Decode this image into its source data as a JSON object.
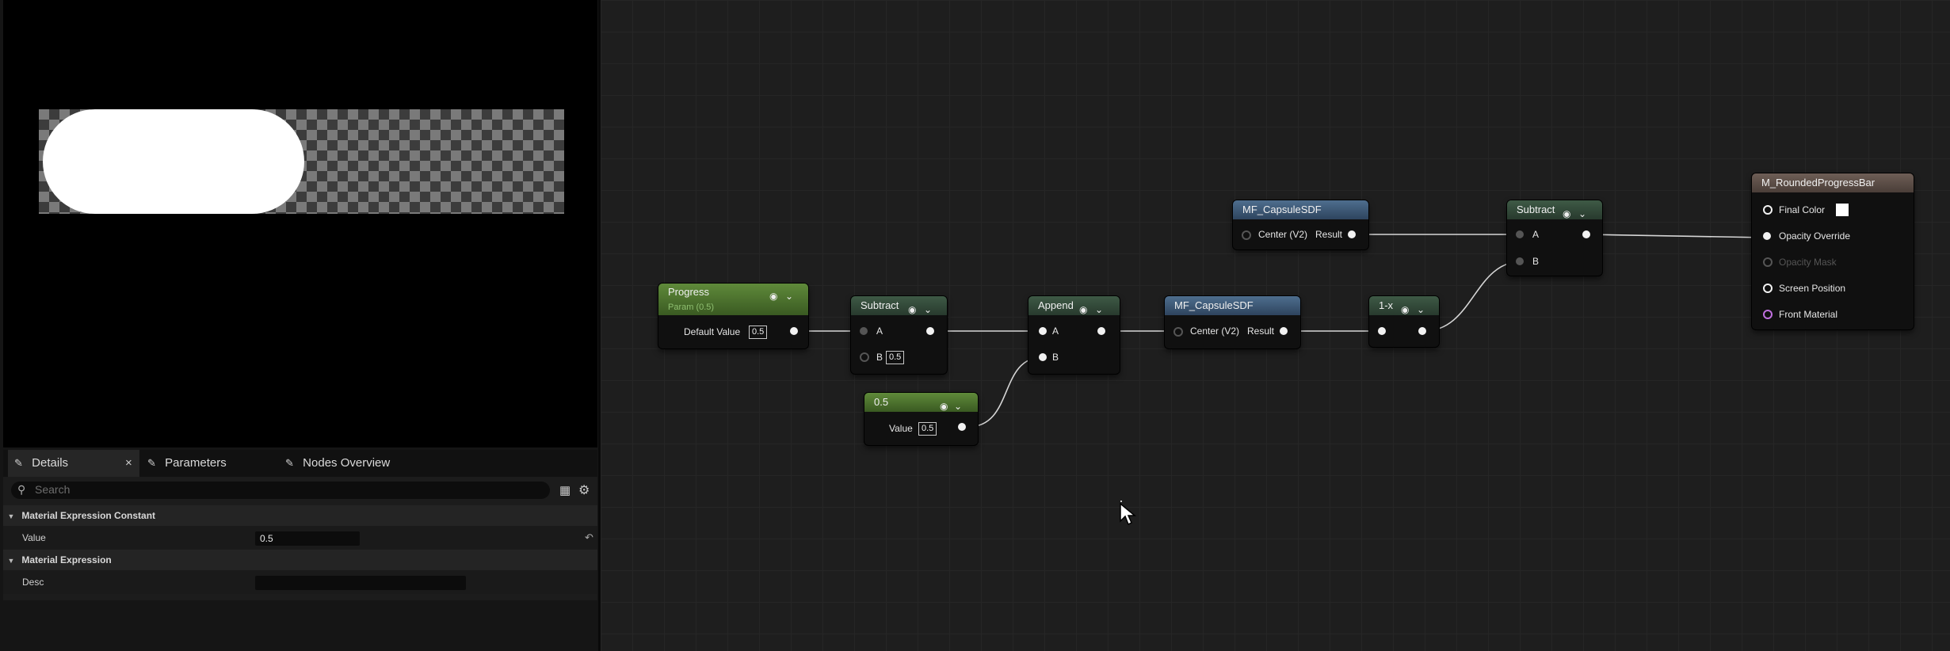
{
  "tabs": {
    "details": "Details",
    "close": "×",
    "parameters": "Parameters",
    "nodes_overview": "Nodes Overview"
  },
  "search": {
    "placeholder": "Search"
  },
  "sections": {
    "constant": {
      "title": "Material Expression Constant",
      "value_label": "Value",
      "value": "0.5"
    },
    "expression": {
      "title": "Material Expression",
      "desc_label": "Desc",
      "desc_value": ""
    }
  },
  "nodes": {
    "progress": {
      "title": "Progress",
      "subtitle": "Param (0.5)",
      "pin_label": "Default Value",
      "value": "0.5"
    },
    "subtract1": {
      "title": "Subtract",
      "pin_a": "A",
      "pin_b": "B",
      "b_value": "0.5"
    },
    "constant": {
      "title": "0.5",
      "pin_label": "Value",
      "value": "0.5"
    },
    "append": {
      "title": "Append",
      "pin_a": "A",
      "pin_b": "B"
    },
    "capsule_bottom": {
      "title": "MF_CapsuleSDF",
      "input": "Center (V2)",
      "output": "Result"
    },
    "capsule_top": {
      "title": "MF_CapsuleSDF",
      "input": "Center (V2)",
      "output": "Result"
    },
    "one_minus": {
      "title": "1-x"
    },
    "subtract2": {
      "title": "Subtract",
      "pin_a": "A",
      "pin_b": "B"
    },
    "material": {
      "title": "M_RoundedProgressBar",
      "final_color": "Final Color",
      "opacity_override": "Opacity Override",
      "opacity_mask": "Opacity Mask",
      "screen_position": "Screen Position",
      "front_material": "Front Material"
    }
  },
  "icons": [
    "pencil-icon",
    "search-icon",
    "grid-icon",
    "gear-icon",
    "reset-icon",
    "collapse-triangle-icon",
    "chevron-down-icon",
    "preview-circle-icon",
    "mouse-cursor-icon"
  ],
  "colors": {
    "param_header": "#5f8a3a",
    "math_header": "#3e5a46",
    "function_header": "#4e6e8e",
    "material_header": "#6e5e56",
    "front_material_pin": "#c070e0"
  }
}
